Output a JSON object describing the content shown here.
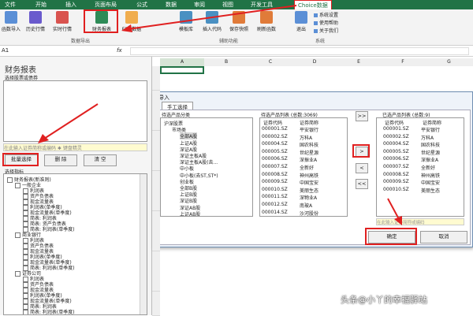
{
  "menu": [
    "文件",
    "开始",
    "插入",
    "页面布局",
    "公式",
    "数据",
    "审阅",
    "视图",
    "开发工具",
    "Choice数据"
  ],
  "ribbon": {
    "buttons": [
      "函数导入",
      "历史行情",
      "实时行情",
      "财务报表",
      "EDB数据",
      "模板库",
      "插入代码",
      "保存快照",
      "刷新函数",
      "退出"
    ],
    "group_data": "数据导出",
    "group_aux": "辅助功能",
    "group_sys": "系统",
    "sys_items": [
      "系统设置",
      "使用帮助",
      "关于我们"
    ]
  },
  "formula_bar": {
    "name_box": "A1",
    "fx": "fx"
  },
  "left_panel": {
    "title": "财务报表",
    "select_label": "选择股票或债券",
    "hint": "在此输入证券简称或编码 ✱ 键盘精灵",
    "btn_batch": "批量选择",
    "btn_delete": "删 除",
    "btn_clear": "清 空",
    "index_label": "选择指标",
    "tree": [
      "财务报表(新准则)",
      "一般企业",
      "利润表",
      "资产负债表",
      "现金流量表",
      "利润表(单季度)",
      "现金流量表(单季度)",
      "简表: 利润表",
      "简表: 资产负债表",
      "简表: 利润表(单季度)",
      "商业银行",
      "利润表",
      "资产负债表",
      "现金流量表",
      "利润表(单季度)",
      "现金流量表(单季度)",
      "简表: 利润表(单季度)",
      "证券公司",
      "利润表",
      "资产负债表",
      "现金流量表",
      "利润表(单季度)",
      "现金流量表(单季度)",
      "简表: 利润表",
      "简表: 利润表(单季度)",
      "保险公司"
    ]
  },
  "dialog": {
    "title": "导入",
    "tab": "手工选择",
    "pending_cat_label": "待选产品分类",
    "pending_list_label": "待选产品列表 (总数:3069)",
    "selected_label": "已选产品列表 (总数:9)",
    "cat_items": [
      "沪深股票",
      "市场类",
      "全部A股",
      "上证A股",
      "深证A股",
      "深证主板A股",
      "深证主板A股(去...",
      "中小板",
      "中小板(去ST,ST*)",
      "创业板",
      "全部B股",
      "上证B股",
      "深证B股",
      "深证AB股",
      "上证AB股"
    ],
    "col_code": "证券代码",
    "col_name": "证券简称",
    "pending_rows": [
      [
        "000001.SZ",
        "平安银行"
      ],
      [
        "000002.SZ",
        "万科A"
      ],
      [
        "000004.SZ",
        "国农科技"
      ],
      [
        "000005.SZ",
        "世纪星源"
      ],
      [
        "000006.SZ",
        "深振业A"
      ],
      [
        "000007.SZ",
        "全新好"
      ],
      [
        "000008.SZ",
        "神州高铁"
      ],
      [
        "000009.SZ",
        "中国宝安"
      ],
      [
        "000010.SZ",
        "美丽生态"
      ],
      [
        "000011.SZ",
        "深物业A"
      ],
      [
        "000012.SZ",
        "南玻A"
      ],
      [
        "000014.SZ",
        "沙河股份"
      ]
    ],
    "selected_rows": [
      [
        "000001.SZ",
        "平安银行"
      ],
      [
        "000002.SZ",
        "万科A"
      ],
      [
        "000004.SZ",
        "国农科技"
      ],
      [
        "000005.SZ",
        "世纪星源"
      ],
      [
        "000006.SZ",
        "深振业A"
      ],
      [
        "000007.SZ",
        "全新好"
      ],
      [
        "000008.SZ",
        "神州高铁"
      ],
      [
        "000009.SZ",
        "中国宝安"
      ],
      [
        "000010.SZ",
        "美丽生态"
      ]
    ],
    "move_buttons": [
      ">>",
      ">",
      "<",
      "<<"
    ],
    "hint": "在此输入证券简称或编码",
    "ok": "确定",
    "cancel": "取消"
  },
  "sheet": {
    "cols": [
      "A",
      "B",
      "C",
      "D",
      "E",
      "F",
      "G"
    ]
  },
  "watermark": "头条@小丫的幸福驿站"
}
